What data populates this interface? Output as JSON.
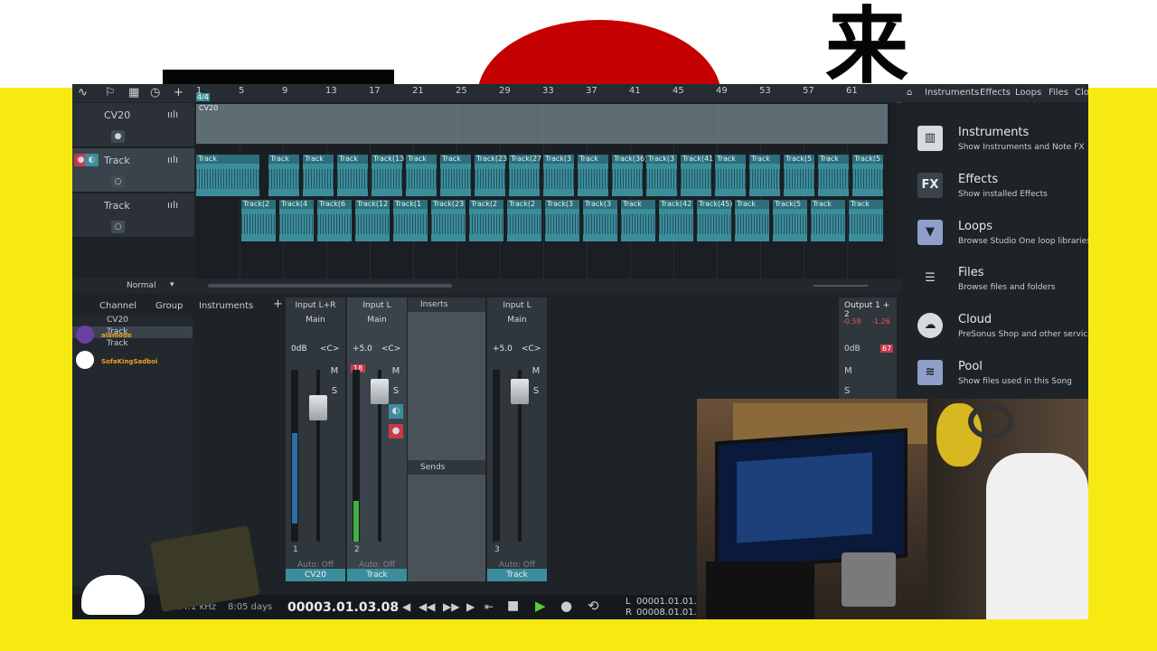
{
  "overlay": {
    "kanji": "来"
  },
  "toolbar": {
    "icons": [
      "curve-tool-icon",
      "paint-tool-icon",
      "grid-icon",
      "clock-icon",
      "add-track-icon"
    ],
    "add_label": "+"
  },
  "ruler": {
    "start_label": "4/4",
    "bars": [
      "1",
      "5",
      "9",
      "13",
      "17",
      "21",
      "25",
      "29",
      "33",
      "37",
      "41",
      "45",
      "49",
      "53",
      "57",
      "61"
    ]
  },
  "tracks": [
    {
      "name": "CV20",
      "clip_label": "CV20"
    },
    {
      "name": "Track",
      "clip_label": "Track"
    },
    {
      "name": "Track"
    }
  ],
  "clips_row2": [
    "Track",
    "Track",
    "Track",
    "Track(13",
    "Track",
    "Track",
    "Track(23",
    "Track(27",
    "Track(3",
    "Track",
    "Track(36)",
    "Track(3",
    "Track(41",
    "Track",
    "Track",
    "Track(5",
    "Track",
    "Track(5"
  ],
  "clips_row3": [
    "Track(2",
    "Track(4",
    "Track(6",
    "Track(12",
    "Track(1",
    "Track(23",
    "Track(2",
    "Track(2",
    "Track(3",
    "Track(3",
    "Track",
    "Track(42",
    "Track(45)",
    "Track",
    "Track(5",
    "Track",
    "Track"
  ],
  "arrange_bottom": {
    "mode": "Normal"
  },
  "mixer_nav": {
    "channel": "Channel",
    "group": "Group",
    "instruments": "Instruments",
    "add": "+"
  },
  "channel_list": [
    "CV20",
    "Track",
    "Track"
  ],
  "chat": [
    {
      "user": "alamode"
    },
    {
      "user": "SofaKingSadboi"
    }
  ],
  "strips": [
    {
      "input": "Input L+R",
      "main": "Main",
      "vol": "0dB",
      "pan": "<C>",
      "num": "1",
      "auto": "Auto: Off",
      "name": "CV20"
    },
    {
      "input": "Input L",
      "main": "Main",
      "vol": "+5.0",
      "pan": "<C>",
      "num": "2",
      "auto": "Auto: Off",
      "name": "Track",
      "clip": "18"
    },
    {
      "input": "Input L",
      "main": "Main",
      "vol": "+5.0",
      "pan": "<C>",
      "num": "3",
      "auto": "Auto: Off",
      "name": "Track"
    }
  ],
  "strip_buttons": {
    "mute": "M",
    "solo": "S"
  },
  "inserts_label": "Inserts",
  "sends_label": "Sends",
  "output": {
    "label": "Output 1 + 2",
    "left": "-0.58",
    "right": "-1.26",
    "vol": "0dB",
    "clip": "67"
  },
  "transport": {
    "sample_rate": "44.1 kHz",
    "record_time": "8:05 days",
    "position": "00003.01.03.08",
    "left_locator": "00001.01.01.0",
    "right_locator": "00008.01.01.0",
    "L": "L",
    "R": "R"
  },
  "browser": {
    "tabs": [
      "Instruments",
      "Effects",
      "Loops",
      "Files",
      "Clo"
    ],
    "items": [
      {
        "title": "Instruments",
        "subtitle": "Show Instruments and Note FX",
        "icon": "piano-icon"
      },
      {
        "title": "Effects",
        "subtitle": "Show installed Effects",
        "icon_text": "FX"
      },
      {
        "title": "Loops",
        "subtitle": "Browse Studio One loop libraries",
        "icon": "loops-icon"
      },
      {
        "title": "Files",
        "subtitle": "Browse files and folders",
        "icon": "files-icon"
      },
      {
        "title": "Cloud",
        "subtitle": "PreSonus Shop and other services",
        "icon": "cloud-icon"
      },
      {
        "title": "Pool",
        "subtitle": "Show files used in this Song",
        "icon": "pool-icon"
      }
    ]
  },
  "colors": {
    "background": "#f7ea13",
    "accent": "#3c8d9c",
    "red": "#c40000"
  }
}
